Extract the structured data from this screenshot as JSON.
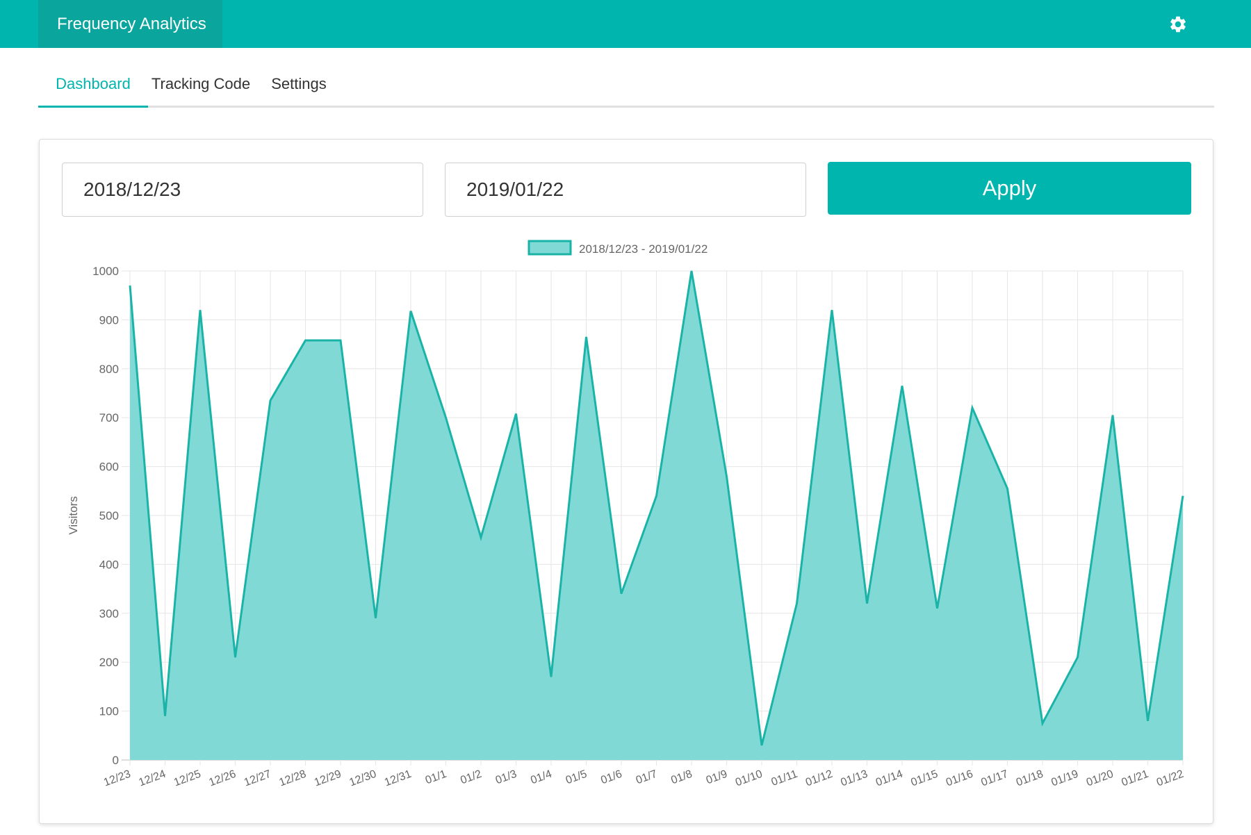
{
  "app": {
    "title": "Frequency Analytics",
    "settings_icon": "gear-icon"
  },
  "tabs": [
    {
      "label": "Dashboard",
      "active": true
    },
    {
      "label": "Tracking Code",
      "active": false
    },
    {
      "label": "Settings",
      "active": false
    }
  ],
  "filters": {
    "start_date": "2018/12/23",
    "end_date": "2019/01/22",
    "apply_label": "Apply"
  },
  "colors": {
    "accent": "#00b5ad",
    "brand_bg": "#0aa59d",
    "area_fill": "#80d9d5",
    "line": "#1ab3a8"
  },
  "chart_data": {
    "type": "area",
    "title": "",
    "xlabel": "",
    "ylabel": "Visitors",
    "ylim": [
      0,
      1000
    ],
    "yticks": [
      0,
      100,
      200,
      300,
      400,
      500,
      600,
      700,
      800,
      900,
      1000
    ],
    "grid": true,
    "legend_position": "top",
    "categories": [
      "12/23",
      "12/24",
      "12/25",
      "12/26",
      "12/27",
      "12/28",
      "12/29",
      "12/30",
      "12/31",
      "01/1",
      "01/2",
      "01/3",
      "01/4",
      "01/5",
      "01/6",
      "01/7",
      "01/8",
      "01/9",
      "01/10",
      "01/11",
      "01/12",
      "01/13",
      "01/14",
      "01/15",
      "01/16",
      "01/17",
      "01/18",
      "01/19",
      "01/20",
      "01/21",
      "01/22"
    ],
    "series": [
      {
        "name": "2018/12/23 - 2019/01/22",
        "values": [
          970,
          90,
          920,
          210,
          735,
          858,
          858,
          290,
          918,
          700,
          455,
          708,
          170,
          865,
          340,
          540,
          1000,
          580,
          30,
          320,
          920,
          320,
          765,
          310,
          720,
          555,
          75,
          210,
          705,
          80,
          540
        ]
      }
    ]
  }
}
